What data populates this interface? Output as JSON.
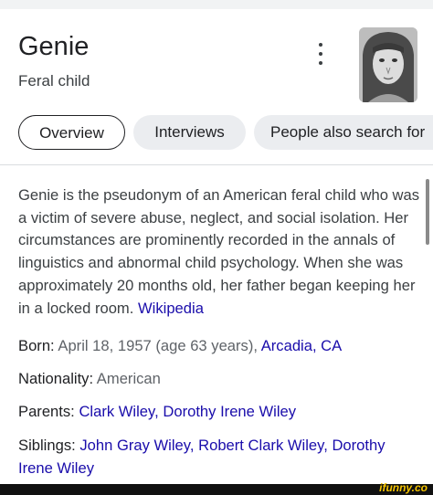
{
  "header": {
    "title": "Genie",
    "subtitle": "Feral child"
  },
  "tabs": [
    {
      "label": "Overview",
      "active": true
    },
    {
      "label": "Interviews",
      "active": false
    },
    {
      "label": "People also search for",
      "active": false
    }
  ],
  "description": {
    "text": "Genie is the pseudonym of an American feral child who was a victim of severe abuse, neglect, and social isolation. Her circumstances are prominently recorded in the annals of linguistics and abnormal child psychology. When she was approximately 20 months old, her father began keeping her in a locked room.",
    "source_link": "Wikipedia"
  },
  "facts": {
    "born": {
      "label": "Born:",
      "text": "April 18, 1957 (age 63 years),",
      "link": "Arcadia, CA"
    },
    "nationality": {
      "label": "Nationality:",
      "text": "American"
    },
    "parents": {
      "label": "Parents:",
      "link1": "Clark Wiley",
      "sep": ",",
      "link2": "Dorothy Irene Wiley"
    },
    "siblings": {
      "label": "Siblings:",
      "link1": "John Gray Wiley",
      "sep1": ",",
      "link2": "Robert Clark Wiley",
      "sep2": ",",
      "link3": "Dorothy Irene Wiley"
    }
  },
  "watermark": "ifunny.co",
  "colors": {
    "link": "#1a0dab",
    "text": "#202124",
    "muted": "#5f6368",
    "chip_bg": "#ebedf0"
  },
  "icons": {
    "menu": "more-vert-icon"
  }
}
